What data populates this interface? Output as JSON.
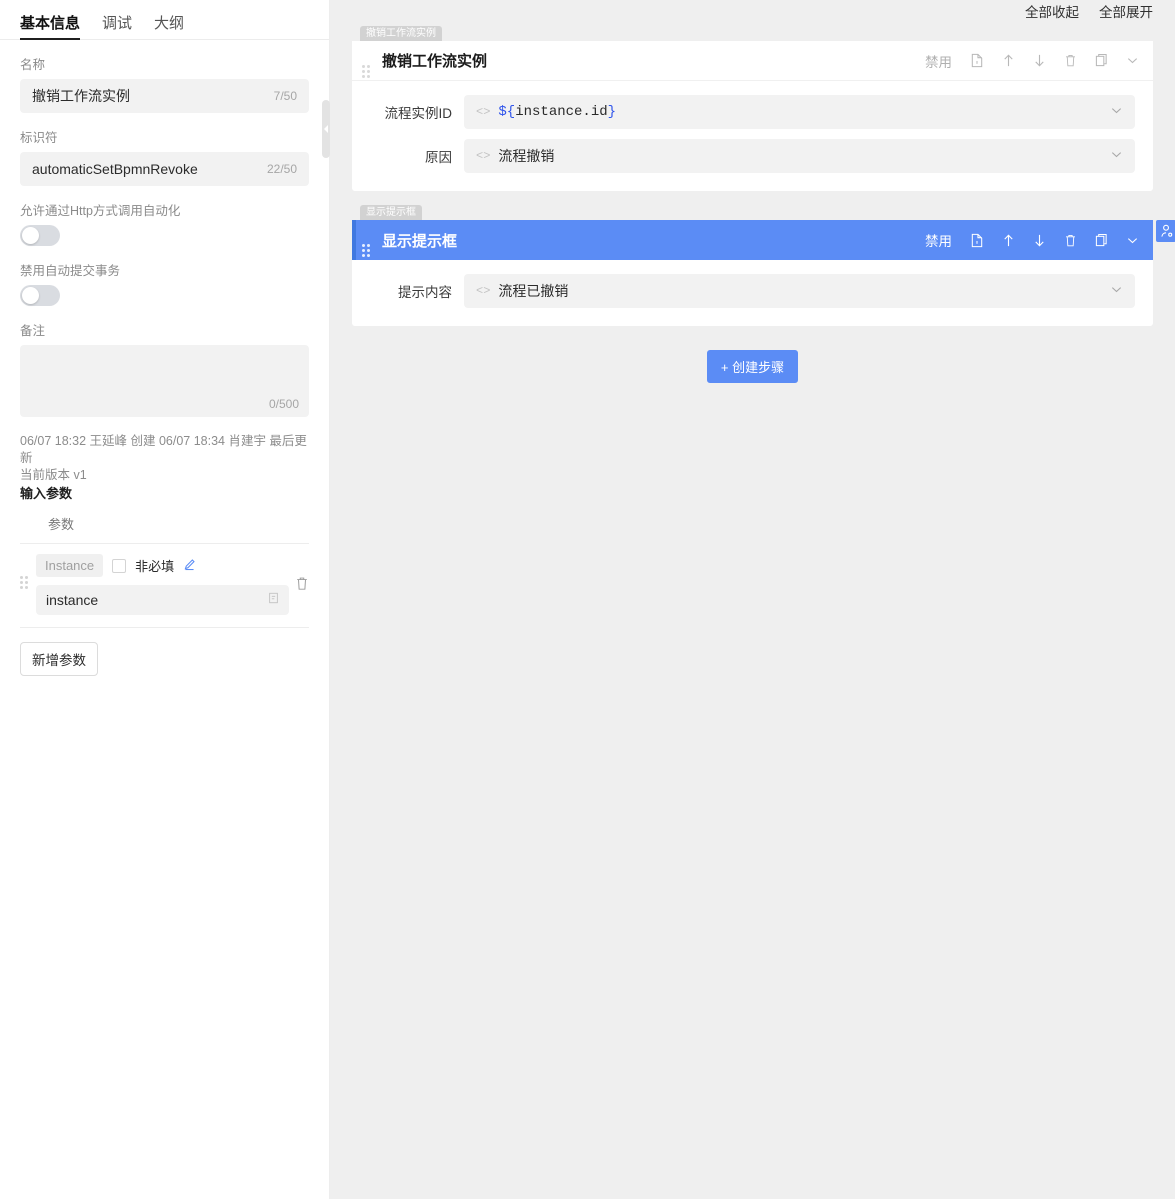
{
  "sidebar": {
    "tabs": [
      {
        "label": "基本信息",
        "active": true
      },
      {
        "label": "调试",
        "active": false
      },
      {
        "label": "大纲",
        "active": false
      }
    ],
    "name_field": {
      "label": "名称",
      "value": "撤销工作流实例",
      "counter": "7/50"
    },
    "identifier_field": {
      "label": "标识符",
      "value": "automaticSetBpmnRevoke",
      "counter": "22/50"
    },
    "http_toggle": {
      "label": "允许通过Http方式调用自动化",
      "state": "off"
    },
    "auto_commit_toggle": {
      "label": "禁用自动提交事务",
      "state": "off"
    },
    "remark_field": {
      "label": "备注",
      "value": "",
      "counter": "0/500"
    },
    "meta": {
      "line1": "06/07 18:32 王延峰 创建 06/07 18:34 肖建宇 最后更新",
      "line2": "当前版本 v1"
    },
    "input_params": {
      "title": "输入参数",
      "column_header": "参数",
      "rows": [
        {
          "pill": "Instance",
          "optional_label": "非必填",
          "optional_checked": false,
          "value": "instance"
        }
      ],
      "add_button": "新增参数"
    },
    "collapse_handle_icon": "chevron-left-icon"
  },
  "canvas": {
    "toolbar": {
      "collapse_all": "全部收起",
      "expand_all": "全部展开"
    },
    "cards": [
      {
        "tag": "撤销工作流实例",
        "title": "撤销工作流实例",
        "selected": false,
        "actions": {
          "disable": "禁用",
          "icons": [
            "doc-icon",
            "arrow-up-icon",
            "arrow-down-icon",
            "trash-icon",
            "copy-icon",
            "chevron-down-icon"
          ]
        },
        "fields": [
          {
            "label": "流程实例ID",
            "value": "${instance.id}",
            "mono": true
          },
          {
            "label": "原因",
            "value": "流程撤销",
            "mono": false
          }
        ]
      },
      {
        "tag": "显示提示框",
        "title": "显示提示框",
        "selected": true,
        "side_badge_icon": "robot-icon",
        "actions": {
          "disable": "禁用",
          "icons": [
            "doc-icon",
            "arrow-up-icon",
            "arrow-down-icon",
            "trash-icon",
            "copy-icon",
            "chevron-down-icon"
          ]
        },
        "fields": [
          {
            "label": "提示内容",
            "value": "流程已撤销",
            "mono": false
          }
        ]
      }
    ],
    "add_step_button": "+ 创建步骤"
  },
  "colors": {
    "accent": "#5b8cf5",
    "accent_dark": "#4078e0",
    "canvas_bg": "#efefef",
    "input_bg": "#f2f2f2",
    "code_blue": "#2f54eb"
  }
}
